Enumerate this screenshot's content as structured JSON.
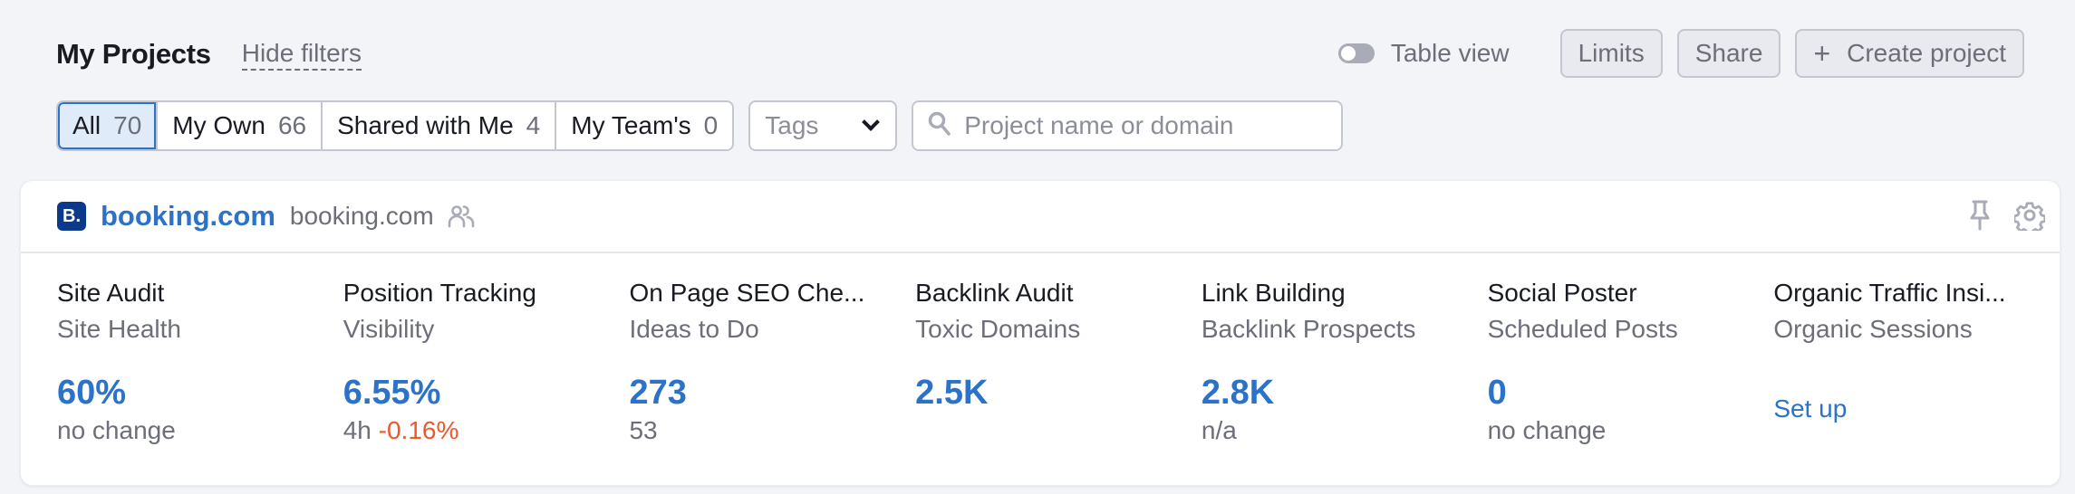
{
  "header": {
    "title": "My Projects",
    "hide_filters": "Hide filters"
  },
  "toolbar": {
    "table_view_label": "Table view",
    "table_view_on": false,
    "limits_label": "Limits",
    "share_label": "Share",
    "create_label": "Create project",
    "create_icon": "plus-icon"
  },
  "filters": {
    "segments": [
      {
        "label": "All",
        "count": "70",
        "active": true
      },
      {
        "label": "My Own",
        "count": "66",
        "active": false
      },
      {
        "label": "Shared with Me",
        "count": "4",
        "active": false
      },
      {
        "label": "My Team's",
        "count": "0",
        "active": false
      }
    ],
    "tags": {
      "label": "Tags",
      "icon": "chevron-down-icon"
    },
    "search": {
      "placeholder": "Project name or domain",
      "value": "",
      "icon": "search-icon"
    }
  },
  "project": {
    "logo_letter": "B.",
    "name": "booking.com",
    "domain": "booking.com",
    "shared_icon": "users-icon",
    "pin_icon": "pin-icon",
    "settings_icon": "gear-icon",
    "widgets": [
      {
        "title": "Site Audit",
        "subtitle": "Site Health",
        "value": "60%",
        "note": "no change"
      },
      {
        "title": "Position Tracking",
        "subtitle": "Visibility",
        "value": "6.55%",
        "note": "4h",
        "change": "-0.16%"
      },
      {
        "title": "On Page SEO Che...",
        "subtitle": "Ideas to Do",
        "value": "273",
        "note": "53"
      },
      {
        "title": "Backlink Audit",
        "subtitle": "Toxic Domains",
        "value": "2.5K",
        "note": ""
      },
      {
        "title": "Link Building",
        "subtitle": "Backlink Prospects",
        "value": "2.8K",
        "note": "n/a"
      },
      {
        "title": "Social Poster",
        "subtitle": "Scheduled Posts",
        "value": "0",
        "note": "no change"
      },
      {
        "title": "Organic Traffic Insi...",
        "subtitle": "Organic Sessions",
        "link": "Set up"
      }
    ]
  },
  "colors": {
    "accent": "#2b72c8",
    "negative": "#f0572b",
    "background": "#f3f4f8",
    "logo_bg": "#0b3a8c"
  }
}
